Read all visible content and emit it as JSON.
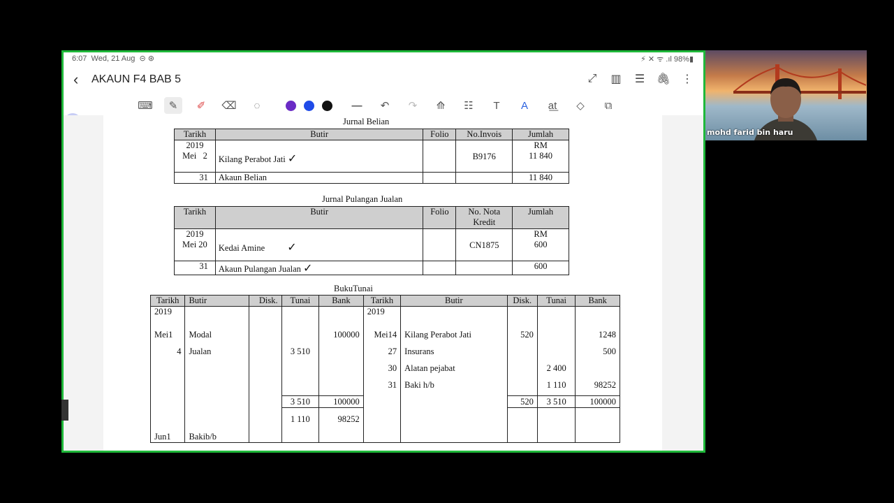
{
  "status_bar": {
    "time": "6:07",
    "date": "Wed, 21 Aug",
    "battery": "98%"
  },
  "header": {
    "title": "AKAUN F4 BAB 5"
  },
  "pen_colors": [
    "#6a2bc5",
    "#1f4be8",
    "#111111"
  ],
  "jurnal_belian": {
    "title": "Jurnal Belian",
    "headers": [
      "Tarikh",
      "Butir",
      "Folio",
      "No.Invois",
      "Jumlah"
    ],
    "row1": {
      "year": "2019",
      "date": "Mei   2",
      "butir": "Kilang Perabot Jati",
      "invois": "B9176",
      "unit": "RM",
      "jumlah": "11 840"
    },
    "row2": {
      "date": "31",
      "butir": "Akaun Belian",
      "jumlah": "11 840"
    }
  },
  "jurnal_pulangan": {
    "title": "Jurnal Pulangan Jualan",
    "headers": [
      "Tarikh",
      "Butir",
      "Folio",
      "No. Nota Kredit",
      "Jumlah"
    ],
    "row1": {
      "year": "2019",
      "date": "Mei 20",
      "butir": "Kedai Amine",
      "nota": "CN1875",
      "unit": "RM",
      "jumlah": "600"
    },
    "row2": {
      "date": "31",
      "butir": "Akaun Pulangan Jualan",
      "jumlah": "600"
    }
  },
  "buku_tunai": {
    "title": "BukuTunai",
    "headers": [
      "Tarikh",
      "Butir",
      "Disk.",
      "Tunai",
      "Bank",
      "Tarikh",
      "Butir",
      "Disk.",
      "Tunai",
      "Bank"
    ],
    "year": "2019",
    "left_rows": [
      {
        "date": "Mei1",
        "butir": "Modal",
        "disk": "",
        "tunai": "",
        "bank": "100000"
      },
      {
        "date": "4",
        "butir": "Jualan",
        "disk": "",
        "tunai": "3 510",
        "bank": ""
      }
    ],
    "right_rows": [
      {
        "date": "Mei14",
        "butir": "Kilang Perabot Jati",
        "disk": "520",
        "tunai": "",
        "bank": "1248"
      },
      {
        "date": "27",
        "butir": "Insurans",
        "disk": "",
        "tunai": "",
        "bank": "500"
      },
      {
        "date": "30",
        "butir": "Alatan pejabat",
        "disk": "",
        "tunai": "2 400",
        "bank": ""
      },
      {
        "date": "31",
        "butir": "Baki h/b",
        "disk": "",
        "tunai": "1 110",
        "bank": "98252"
      }
    ],
    "left_total": {
      "tunai": "3 510",
      "bank": "100000"
    },
    "right_total": {
      "disk": "520",
      "tunai": "3 510",
      "bank": "100000"
    },
    "carry": {
      "date": "Jun1",
      "butir": "Bakib/b",
      "tunai": "1 110",
      "bank": "98252"
    }
  },
  "webcam": {
    "name": "mohd farid bin haru"
  }
}
